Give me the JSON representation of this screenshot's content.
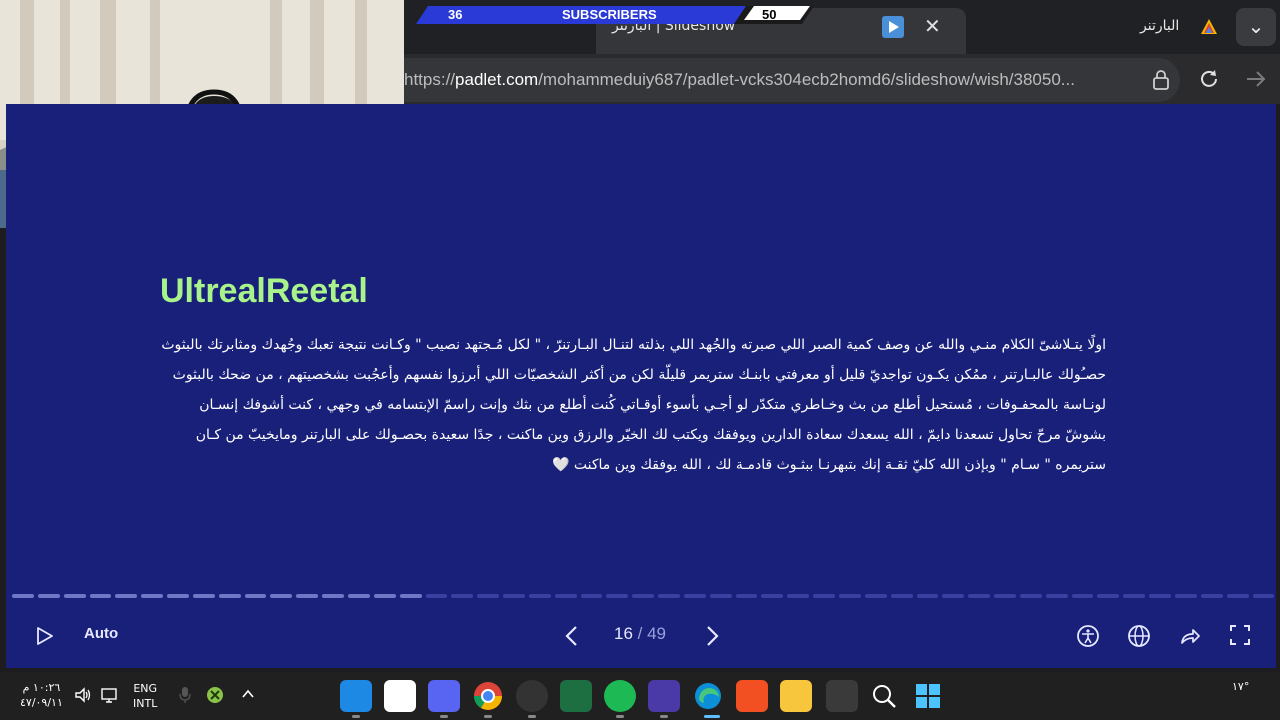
{
  "browser": {
    "tab_title": "البارتنر | Slideshow",
    "tab_right_title": "البارتنر",
    "url_prefix": "https://",
    "url_host": "padlet.com",
    "url_path": "/mohammeduiy687/padlet-vcks304ecb2homd6/slideshow/wish/38050..."
  },
  "overlay": {
    "subs_left": "36",
    "subs_label": "SUBSCRIBERS",
    "subs_right": "50"
  },
  "post": {
    "title": "UltrealReetal",
    "body": "اولًا يتـلاشىّ الكلام منـي والله عن وصف كمية الصبر اللي صبرته والجُهد اللي بذلته لتنـال البـارتنرّ ، \" لكل مُـجتهد نصيب \" وكـانت نتيجة تعبك وجُهدك ومثابرتك بالبثوث حصـُولك عالبـارتنر ، ممُكن يكـون تواجديّ قليل أو معرفتي بابنـك ستريمر قليلّة لكن من أكثر الشخصيّات اللي أبرزوا نفسهم وأعجُبت بشخصيتهم ، من ضحك بالبثوث لونـاسة بالمحفـوفات ، مُستحيل أطلع من بث وخـاطري متكدّر لو أجـي بأسوء أوقـاتي كُنت أطلع من بثك وإنت راسمّ الإبتسامه في وجهي ، كنت أشوفك إنسـان بشوشّ مرحّ تحاول تسعدنا دايمّ ، الله يسعدك سعادة الدارين ويوفقك ويكتب لك الخيّر والرزق وين ماكنت ، جدًا سعيدة بحصـولك على البارتنر ومايخيبّ من كـان ستريمره \" سـام \" وبإذن الله كليّ ثقـة إنك بتبهرنـا ببثـوث قادمـة لك ، الله يوفقك وين ماكنت 🤍"
  },
  "controls": {
    "auto_label": "Auto",
    "current": "16",
    "separator": " / ",
    "total": "49",
    "progress_total": 49,
    "progress_current": 16
  },
  "taskbar": {
    "time": "١٠:٢٦ م",
    "date": "٤٧/٠٩/١١",
    "lang_1": "ENG",
    "lang_2": "INTL",
    "weather": "١٧°"
  },
  "colors": {
    "page_bg": "#19207a",
    "title_green": "#a8f48a",
    "browser_dark": "#202124"
  }
}
